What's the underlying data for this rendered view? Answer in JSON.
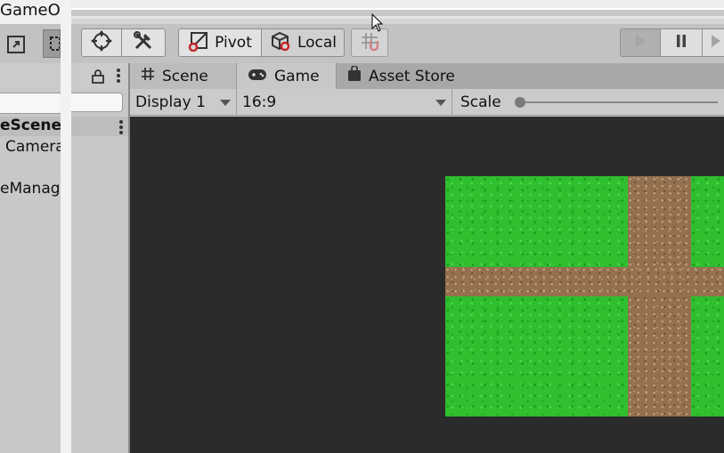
{
  "background_window": {
    "title": "GameOb",
    "hierarchy": {
      "scene_name": "eScene",
      "items": [
        "Camera",
        "eManager"
      ]
    }
  },
  "toolbar": {
    "pivot_label": "Pivot",
    "local_label": "Local"
  },
  "tabs": [
    {
      "label": "Scene",
      "icon": "grid-icon"
    },
    {
      "label": "Game",
      "icon": "gamepad-icon"
    },
    {
      "label": "Asset Store",
      "icon": "bag-icon"
    }
  ],
  "game_toolbar": {
    "display_value": "Display 1",
    "aspect_value": "16:9",
    "scale_label": "Scale"
  },
  "colors": {
    "game_background": "#2b2b2b",
    "grass": "#2fbf2f",
    "dirt": "#94704e"
  }
}
